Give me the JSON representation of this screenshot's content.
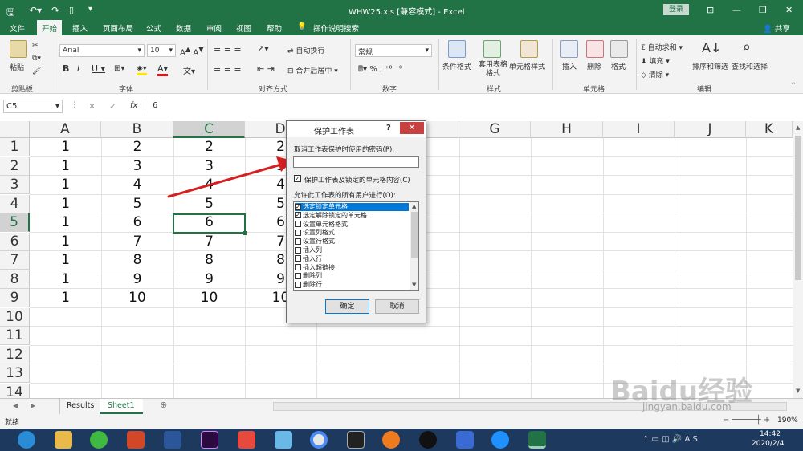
{
  "titlebar": {
    "filename": "WHW25.xls",
    "mode": "[兼容模式]",
    "app": "Excel",
    "login": "登录"
  },
  "tabs": [
    "文件",
    "开始",
    "插入",
    "页面布局",
    "公式",
    "数据",
    "审阅",
    "视图",
    "帮助",
    "操作说明搜索"
  ],
  "share": "共享",
  "ribbon": {
    "paste": "粘贴",
    "clipboard": "剪贴板",
    "font_name": "Arial",
    "font_size": "10",
    "font_group": "字体",
    "wrap": "自动换行",
    "merge": "合并后居中",
    "align_group": "对齐方式",
    "number_format": "常规",
    "number_group": "数字",
    "cond": "条件格式",
    "table_fmt": "套用表格格式",
    "cell_style": "单元格样式",
    "style_group": "样式",
    "insert": "插入",
    "delete": "删除",
    "format": "格式",
    "cells_group": "单元格",
    "autosum": "自动求和",
    "fill": "填充",
    "clear": "清除",
    "sort": "排序和筛选",
    "find": "查找和选择",
    "edit_group": "编辑"
  },
  "formula": {
    "namebox": "C5",
    "fx": "fx",
    "value": "6"
  },
  "columns": [
    "A",
    "B",
    "C",
    "D",
    "",
    "G",
    "H",
    "I",
    "J",
    "K"
  ],
  "rows": [
    "1",
    "2",
    "3",
    "4",
    "5",
    "6",
    "7",
    "8",
    "9",
    "10",
    "11",
    "12",
    "13",
    "14"
  ],
  "data": [
    [
      "1",
      "2",
      "2",
      "2"
    ],
    [
      "1",
      "3",
      "3",
      "3"
    ],
    [
      "1",
      "4",
      "4",
      "4"
    ],
    [
      "1",
      "5",
      "5",
      "5"
    ],
    [
      "1",
      "6",
      "6",
      "6"
    ],
    [
      "1",
      "7",
      "7",
      "7"
    ],
    [
      "1",
      "8",
      "8",
      "8"
    ],
    [
      "1",
      "9",
      "9",
      "9"
    ],
    [
      "1",
      "10",
      "10",
      "10"
    ]
  ],
  "dialog": {
    "title": "保护工作表",
    "help": "?",
    "pw_label": "取消工作表保护时使用的密码(P):",
    "protect_label": "保护工作表及锁定的单元格内容(C)",
    "allow_label": "允许此工作表的所有用户进行(O):",
    "options": [
      {
        "label": "选定锁定单元格",
        "checked": true,
        "selected": true
      },
      {
        "label": "选定解除锁定的单元格",
        "checked": true
      },
      {
        "label": "设置单元格格式",
        "checked": false
      },
      {
        "label": "设置列格式",
        "checked": false
      },
      {
        "label": "设置行格式",
        "checked": false
      },
      {
        "label": "插入列",
        "checked": false
      },
      {
        "label": "插入行",
        "checked": false
      },
      {
        "label": "插入超链接",
        "checked": false
      },
      {
        "label": "删除列",
        "checked": false
      },
      {
        "label": "删除行",
        "checked": false
      }
    ],
    "ok": "确定",
    "cancel": "取消"
  },
  "sheets": [
    "Results",
    "Sheet1"
  ],
  "status": {
    "ready": "就绪",
    "zoom": "190%"
  },
  "clock": {
    "time": "14:42",
    "date": "2020/2/4"
  },
  "watermark": "Baidu经验",
  "watermark_url": "jingyan.baidu.com",
  "colors": {
    "excel_green": "#217346",
    "taskbar": "#1d3a5e",
    "arrow": "#d62020"
  }
}
